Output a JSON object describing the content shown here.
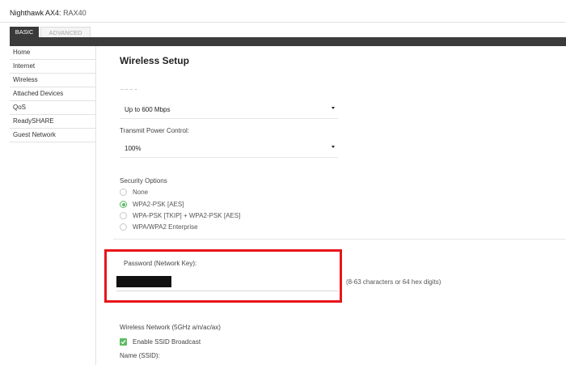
{
  "header": {
    "app_name": "Nighthawk AX4:",
    "model": "RAX40"
  },
  "tabs": [
    {
      "label": "BASIC"
    },
    {
      "label": "ADVANCED"
    }
  ],
  "sidebar": {
    "items": [
      {
        "label": "Home"
      },
      {
        "label": "Internet"
      },
      {
        "label": "Wireless"
      },
      {
        "label": "Attached Devices"
      },
      {
        "label": "QoS"
      },
      {
        "label": "ReadySHARE"
      },
      {
        "label": "Guest Network"
      }
    ]
  },
  "main": {
    "title": "Wireless Setup",
    "mode_label_cut": "~~~~",
    "mode_value": "Up to 600 Mbps",
    "tx_power_label": "Transmit Power Control:",
    "tx_power_value": "100%",
    "security": {
      "label": "Security Options",
      "options": [
        {
          "label": "None",
          "checked": false
        },
        {
          "label": "WPA2-PSK [AES]",
          "checked": true
        },
        {
          "label": "WPA-PSK [TKIP] + WPA2-PSK [AES]",
          "checked": false
        },
        {
          "label": "WPA/WPA2 Enterprise",
          "checked": false
        }
      ]
    },
    "password": {
      "label": "Password (Network Key):",
      "hint": "(8-63 characters or 64 hex digits)"
    },
    "wireless_5g_label": "Wireless Network (5GHz a/n/ac/ax)",
    "ssid_broadcast_label": "Enable SSID Broadcast",
    "ssid_broadcast_checked": true,
    "ssid_label": "Name (SSID):"
  },
  "colors": {
    "accent_green": "#5dbb63",
    "highlight_red": "#e8141b",
    "dark_bar": "#3b3b3b"
  }
}
